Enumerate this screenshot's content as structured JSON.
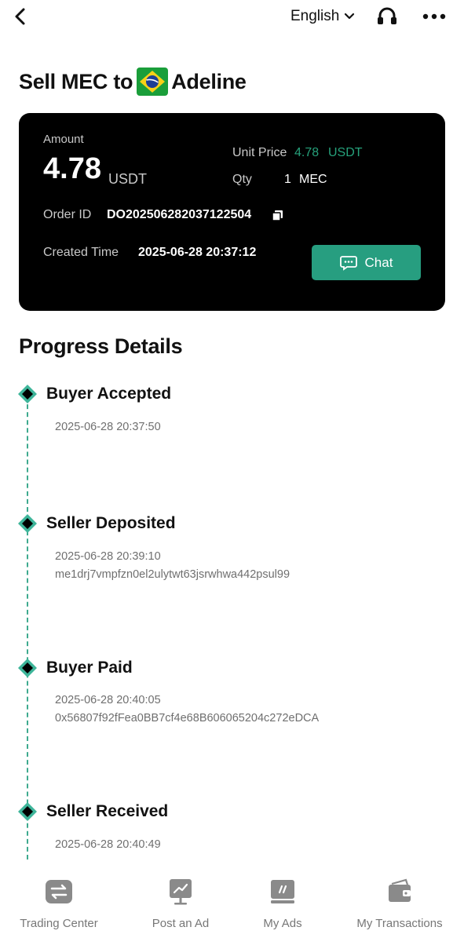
{
  "header": {
    "language": "English",
    "icons": [
      "back-arrow-icon",
      "chevron-down-icon",
      "headset-icon",
      "more-dots-icon"
    ]
  },
  "title": {
    "prefix": "Sell MEC to",
    "flag": "brazil-flag-icon",
    "counterparty": "Adeline"
  },
  "order": {
    "amount_label": "Amount",
    "amount_value": "4.78",
    "amount_unit": "USDT",
    "unit_price_label": "Unit Price",
    "unit_price_value": "4.78",
    "unit_price_unit": "USDT",
    "qty_label": "Qty",
    "qty_value": "1",
    "qty_unit": "MEC",
    "order_id_label": "Order ID",
    "order_id_value": "DO202506282037122504",
    "created_label": "Created Time",
    "created_value": "2025-06-28 20:37:12",
    "chat_label": "Chat"
  },
  "progress": {
    "title": "Progress Details",
    "steps": [
      {
        "title": "Buyer Accepted",
        "time": "2025-06-28 20:37:50",
        "hash": ""
      },
      {
        "title": "Seller Deposited",
        "time": "2025-06-28 20:39:10",
        "hash": "me1drj7vmpfzn0el2ulytwt63jsrwhwa442psul99"
      },
      {
        "title": "Buyer Paid",
        "time": "2025-06-28 20:40:05",
        "hash": "0x56807f92fFea0BB7cf4e68B606065204c272eDCA"
      },
      {
        "title": "Seller Received",
        "time": "2025-06-28 20:40:49",
        "hash": ""
      }
    ]
  },
  "nav": {
    "items": [
      {
        "label": "Trading Center",
        "icon": "swap-icon"
      },
      {
        "label": "Post an Ad",
        "icon": "chart-board-icon"
      },
      {
        "label": "My Ads",
        "icon": "ads-icon"
      },
      {
        "label": "My Transactions",
        "icon": "wallet-icon"
      }
    ]
  },
  "colors": {
    "accent": "#279e80",
    "price_green": "#26a17b",
    "card_bg": "#000000",
    "timeline": "#3eaa8f",
    "nav_icon": "#8a8a8a"
  }
}
